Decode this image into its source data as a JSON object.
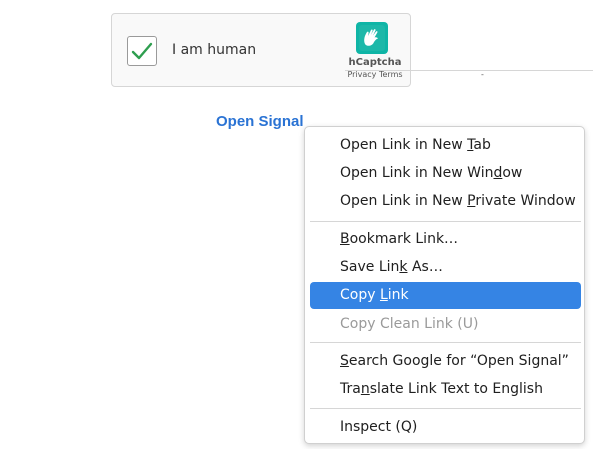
{
  "captcha": {
    "checkbox_label": "I am human",
    "brand": "hCaptcha",
    "privacy_link": "Privacy",
    "link_separator": "-",
    "terms_link": "Terms",
    "check_color": "#2e9e4f"
  },
  "page": {
    "link_text": "Open Signal",
    "link_color": "#2a73d4"
  },
  "context_menu": {
    "highlight_color": "#3584e4",
    "items": [
      {
        "pre": "Open Link in New ",
        "acc": "T",
        "post": "ab",
        "state": "normal"
      },
      {
        "pre": "Open Link in New Win",
        "acc": "d",
        "post": "ow",
        "state": "normal"
      },
      {
        "pre": "Open Link in New ",
        "acc": "P",
        "post": "rivate Window",
        "state": "normal"
      },
      {
        "pre": "",
        "acc": "B",
        "post": "ookmark Link…",
        "state": "normal"
      },
      {
        "pre": "Save Lin",
        "acc": "k",
        "post": " As…",
        "state": "normal"
      },
      {
        "pre": "Copy ",
        "acc": "L",
        "post": "ink",
        "state": "highlighted"
      },
      {
        "pre": "Copy Clean Link (U)",
        "acc": "",
        "post": "",
        "state": "disabled"
      },
      {
        "pre": "",
        "acc": "S",
        "post": "earch Google for “Open Signal”",
        "state": "normal"
      },
      {
        "pre": "Tra",
        "acc": "n",
        "post": "slate Link Text to English",
        "state": "normal"
      },
      {
        "pre": "Inspect (Q)",
        "acc": "",
        "post": "",
        "state": "normal"
      }
    ]
  }
}
